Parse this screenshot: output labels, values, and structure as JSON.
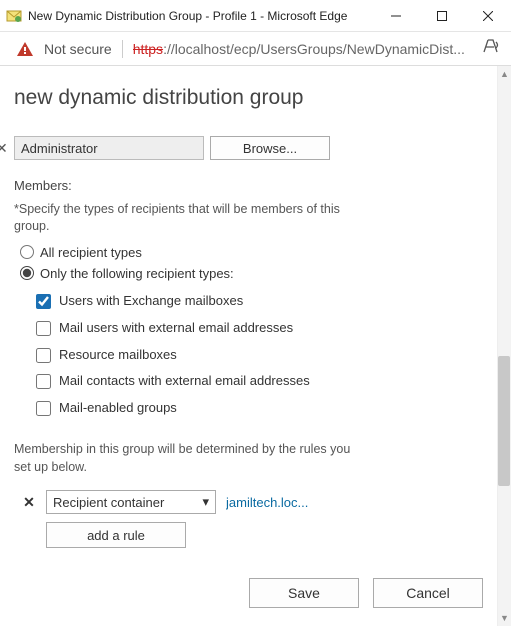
{
  "window": {
    "title": "New Dynamic Distribution Group - Profile 1 - Microsoft Edge"
  },
  "address": {
    "not_secure": "Not secure",
    "protocol": "https",
    "rest": "://localhost/ecp/UsersGroups/NewDynamicDist..."
  },
  "page": {
    "heading": "new dynamic distribution group",
    "owner_value": "Administrator",
    "browse": "Browse...",
    "members_label": "Members:",
    "members_hint": "*Specify the types of recipients that will be members of this group.",
    "radios": {
      "all": "All recipient types",
      "only": "Only the following recipient types:"
    },
    "checks": {
      "exchange": "Users with Exchange mailboxes",
      "mailusers": "Mail users with external email addresses",
      "resource": "Resource mailboxes",
      "contacts": "Mail contacts with external email addresses",
      "groups": "Mail-enabled groups"
    },
    "rules_hint": "Membership in this group will be determined by the rules you set up below.",
    "rule": {
      "field": "Recipient container",
      "value": "jamiltech.loc..."
    },
    "add_rule": "add a rule",
    "save": "Save",
    "cancel": "Cancel"
  }
}
